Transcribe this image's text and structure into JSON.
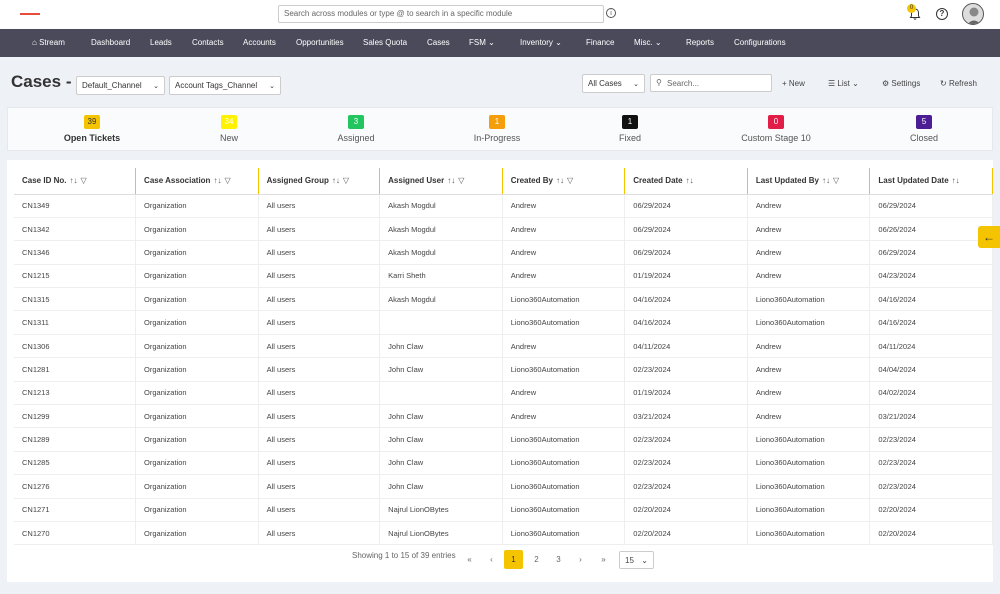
{
  "topbar": {
    "search_placeholder": "Search across modules or type @ to search in a specific module",
    "notifications_count": "0"
  },
  "nav": {
    "items": [
      "Stream",
      "Dashboard",
      "Leads",
      "Contacts",
      "Accounts",
      "Opportunities",
      "Sales Quota",
      "Cases",
      "FSM",
      "Inventory",
      "Finance",
      "Misc.",
      "Reports",
      "Configurations"
    ],
    "active": "Cases"
  },
  "header": {
    "title": "Cases",
    "channel_select": "Default_Channel",
    "tags_select": "Account Tags_Channel",
    "filter_select": "All Cases",
    "search_placeholder": "Search...",
    "new_label": "New",
    "list_label": "List",
    "settings_label": "Settings",
    "refresh_label": "Refresh"
  },
  "stages": [
    {
      "count": "39",
      "label": "Open Tickets",
      "color": "#f5c400",
      "text_color": "#333333"
    },
    {
      "count": "34",
      "label": "New",
      "color": "#fff200",
      "text_color": "#ffffff"
    },
    {
      "count": "3",
      "label": "Assigned",
      "color": "#22c55e",
      "text_color": "#ffffff"
    },
    {
      "count": "1",
      "label": "In-Progress",
      "color": "#f59e0b",
      "text_color": "#ffffff"
    },
    {
      "count": "1",
      "label": "Fixed",
      "color": "#111111",
      "text_color": "#ffffff"
    },
    {
      "count": "0",
      "label": "Custom Stage 10",
      "color": "#e11d48",
      "text_color": "#ffffff"
    },
    {
      "count": "5",
      "label": "Closed",
      "color": "#4c1d95",
      "text_color": "#ffffff"
    }
  ],
  "table": {
    "columns": [
      "Case ID No.",
      "Case Association",
      "Assigned Group",
      "Assigned User",
      "Created By",
      "Created Date",
      "Last Updated By",
      "Last Updated Date"
    ],
    "rows": [
      [
        "CN1349",
        "Organization",
        "All users",
        "Akash Mogdul",
        "Andrew",
        "06/29/2024",
        "Andrew",
        "06/29/2024"
      ],
      [
        "CN1342",
        "Organization",
        "All users",
        "Akash Mogdul",
        "Andrew",
        "06/29/2024",
        "Andrew",
        "06/26/2024"
      ],
      [
        "CN1346",
        "Organization",
        "All users",
        "Akash Mogdul",
        "Andrew",
        "06/29/2024",
        "Andrew",
        "06/29/2024"
      ],
      [
        "CN1215",
        "Organization",
        "All users",
        "Karri Sheth",
        "Andrew",
        "01/19/2024",
        "Andrew",
        "04/23/2024"
      ],
      [
        "CN1315",
        "Organization",
        "All users",
        "Akash Mogdul",
        "Liono360Automation",
        "04/16/2024",
        "Liono360Automation",
        "04/16/2024"
      ],
      [
        "CN1311",
        "Organization",
        "All users",
        "",
        "Liono360Automation",
        "04/16/2024",
        "Liono360Automation",
        "04/16/2024"
      ],
      [
        "CN1306",
        "Organization",
        "All users",
        "John Claw",
        "Andrew",
        "04/11/2024",
        "Andrew",
        "04/11/2024"
      ],
      [
        "CN1281",
        "Organization",
        "All users",
        "John Claw",
        "Liono360Automation",
        "02/23/2024",
        "Andrew",
        "04/04/2024"
      ],
      [
        "CN1213",
        "Organization",
        "All users",
        "",
        "Andrew",
        "01/19/2024",
        "Andrew",
        "04/02/2024"
      ],
      [
        "CN1299",
        "Organization",
        "All users",
        "John Claw",
        "Andrew",
        "03/21/2024",
        "Andrew",
        "03/21/2024"
      ],
      [
        "CN1289",
        "Organization",
        "All users",
        "John Claw",
        "Liono360Automation",
        "02/23/2024",
        "Liono360Automation",
        "02/23/2024"
      ],
      [
        "CN1285",
        "Organization",
        "All users",
        "John Claw",
        "Liono360Automation",
        "02/23/2024",
        "Liono360Automation",
        "02/23/2024"
      ],
      [
        "CN1276",
        "Organization",
        "All users",
        "John Claw",
        "Liono360Automation",
        "02/23/2024",
        "Liono360Automation",
        "02/23/2024"
      ],
      [
        "CN1271",
        "Organization",
        "All users",
        "Najrul LionOBytes",
        "Liono360Automation",
        "02/20/2024",
        "Liono360Automation",
        "02/20/2024"
      ],
      [
        "CN1270",
        "Organization",
        "All users",
        "Najrul LionOBytes",
        "Liono360Automation",
        "02/20/2024",
        "Liono360Automation",
        "02/20/2024"
      ]
    ]
  },
  "pagination": {
    "summary": "Showing 1 to 15 of 39 entries",
    "pages": [
      "1",
      "2",
      "3"
    ],
    "current": "1",
    "per_page": "15"
  },
  "colors": {
    "accent": "#f5c400",
    "nav_bg": "#4a4a5a"
  }
}
